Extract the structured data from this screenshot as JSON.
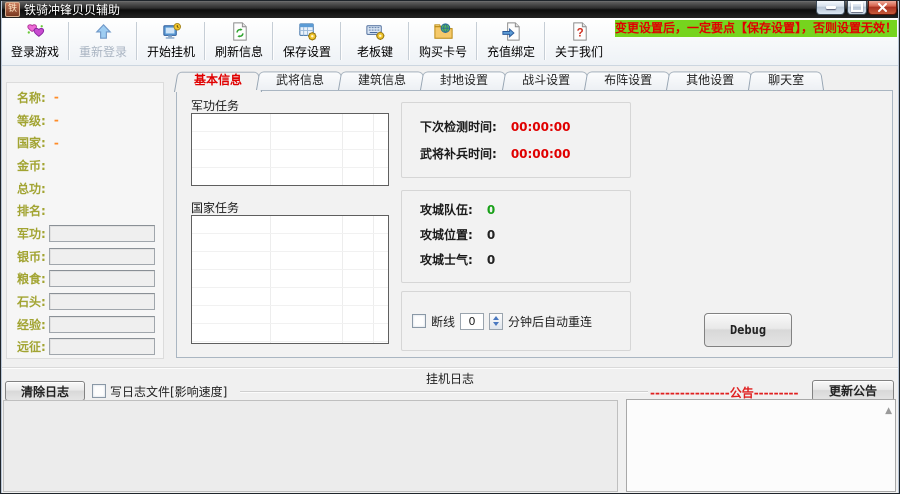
{
  "window": {
    "title": "铁骑冲锋贝贝辅助",
    "icon_text": "铁",
    "banner": "变更设置后，一定要点【保存设置】，否则设置无效！"
  },
  "toolbar": {
    "items": [
      {
        "label": "登录游戏",
        "icon": "hearts-icon",
        "disabled": false
      },
      {
        "label": "重新登录",
        "icon": "arrow-up-icon",
        "disabled": true
      },
      {
        "label": "开始挂机",
        "icon": "monitor-clock-icon",
        "disabled": false
      },
      {
        "label": "刷新信息",
        "icon": "refresh-doc-icon",
        "disabled": false
      },
      {
        "label": "保存设置",
        "icon": "table-gear-icon",
        "disabled": false
      },
      {
        "label": "老板键",
        "icon": "keyboard-gear-icon",
        "disabled": false
      },
      {
        "label": "购买卡号",
        "icon": "folder-globe-icon",
        "disabled": false
      },
      {
        "label": "充值绑定",
        "icon": "doc-arrow-icon",
        "disabled": false
      },
      {
        "label": "关于我们",
        "icon": "doc-question-icon",
        "disabled": false
      }
    ]
  },
  "sidebar": {
    "stats": [
      {
        "label": "名称:",
        "value": "-"
      },
      {
        "label": "等级:",
        "value": "-"
      },
      {
        "label": "国家:",
        "value": "-"
      },
      {
        "label": "金币:",
        "value": ""
      },
      {
        "label": "总功:",
        "value": ""
      },
      {
        "label": "排名:",
        "value": ""
      }
    ],
    "fields": [
      {
        "label": "军功:",
        "value": ""
      },
      {
        "label": "银币:",
        "value": ""
      },
      {
        "label": "粮食:",
        "value": ""
      },
      {
        "label": "石头:",
        "value": ""
      },
      {
        "label": "经验:",
        "value": ""
      },
      {
        "label": "远征:",
        "value": ""
      }
    ]
  },
  "tabs": [
    {
      "label": "基本信息",
      "active": true
    },
    {
      "label": "武将信息",
      "active": false
    },
    {
      "label": "建筑信息",
      "active": false
    },
    {
      "label": "封地设置",
      "active": false
    },
    {
      "label": "战斗设置",
      "active": false
    },
    {
      "label": "布阵设置",
      "active": false
    },
    {
      "label": "其他设置",
      "active": false
    },
    {
      "label": "聊天室",
      "active": false
    }
  ],
  "basic_tab": {
    "task_lists": [
      {
        "title": "军功任务"
      },
      {
        "title": "国家任务"
      }
    ],
    "timers": [
      {
        "label": "下次检测时间:",
        "value": "00:00:00"
      },
      {
        "label": "武将补兵时间:",
        "value": "00:00:00"
      }
    ],
    "siege": [
      {
        "label": "攻城队伍:",
        "value": "0"
      },
      {
        "label": "攻城位置:",
        "value": "0"
      },
      {
        "label": "攻城士气:",
        "value": "0"
      }
    ],
    "reconnect": {
      "label": "断线",
      "minutes": "0",
      "suffix": "分钟后自动重连"
    },
    "debug_button": "Debug"
  },
  "log_section": {
    "title": "挂机日志",
    "clear_button": "清除日志",
    "write_log_checkbox": "写日志文件[影响速度]"
  },
  "announcement": {
    "divider_text": "----------------公告---------",
    "update_button": "更新公告"
  },
  "colors": {
    "banner_bg": "#76d41e",
    "alert_red": "#e00000",
    "ok_green": "#18a018",
    "label_olive": "#a2a432",
    "value_orange": "#ff8c28",
    "titlebar_dark": "#1c1c1c"
  }
}
